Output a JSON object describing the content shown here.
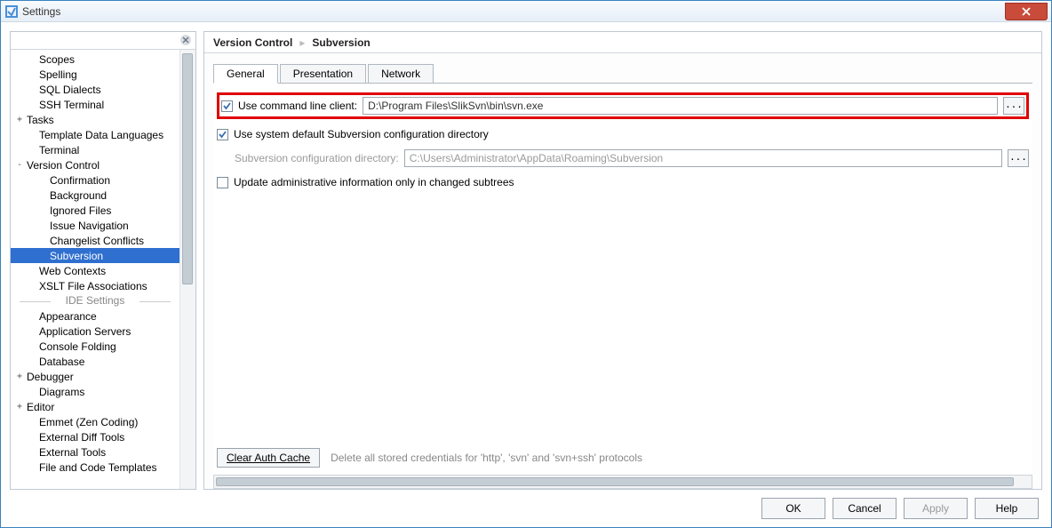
{
  "window": {
    "title": "Settings"
  },
  "breadcrumb": {
    "root": "Version Control",
    "leaf": "Subversion"
  },
  "tabs": {
    "general": "General",
    "presentation": "Presentation",
    "network": "Network"
  },
  "form": {
    "cli_label": "Use command line client:",
    "cli_value": "D:\\Program Files\\SlikSvn\\bin\\svn.exe",
    "sysdefault_label": "Use system default Subversion configuration directory",
    "confdir_label": "Subversion configuration directory:",
    "confdir_value": "C:\\Users\\Administrator\\AppData\\Roaming\\Subversion",
    "update_label": "Update administrative information only in changed subtrees",
    "clear_cache_btn": "Clear Auth Cache",
    "clear_cache_desc": "Delete all stored credentials for 'http', 'svn' and 'svn+ssh' protocols"
  },
  "tree": {
    "items": [
      {
        "label": "Scopes",
        "depth": 1
      },
      {
        "label": "Spelling",
        "depth": 1
      },
      {
        "label": "SQL Dialects",
        "depth": 1
      },
      {
        "label": "SSH Terminal",
        "depth": 1
      },
      {
        "label": "Tasks",
        "depth": 0,
        "exp": "+"
      },
      {
        "label": "Template Data Languages",
        "depth": 1
      },
      {
        "label": "Terminal",
        "depth": 1
      },
      {
        "label": "Version Control",
        "depth": 0,
        "exp": "-"
      },
      {
        "label": "Confirmation",
        "depth": 2
      },
      {
        "label": "Background",
        "depth": 2
      },
      {
        "label": "Ignored Files",
        "depth": 2
      },
      {
        "label": "Issue Navigation",
        "depth": 2
      },
      {
        "label": "Changelist Conflicts",
        "depth": 2
      },
      {
        "label": "Subversion",
        "depth": 2,
        "selected": true
      },
      {
        "label": "Web Contexts",
        "depth": 1
      },
      {
        "label": "XSLT File Associations",
        "depth": 1
      },
      {
        "section": "IDE Settings"
      },
      {
        "label": "Appearance",
        "depth": 1
      },
      {
        "label": "Application Servers",
        "depth": 1
      },
      {
        "label": "Console Folding",
        "depth": 1
      },
      {
        "label": "Database",
        "depth": 1
      },
      {
        "label": "Debugger",
        "depth": 0,
        "exp": "+"
      },
      {
        "label": "Diagrams",
        "depth": 1
      },
      {
        "label": "Editor",
        "depth": 0,
        "exp": "+"
      },
      {
        "label": "Emmet (Zen Coding)",
        "depth": 1
      },
      {
        "label": "External Diff Tools",
        "depth": 1
      },
      {
        "label": "External Tools",
        "depth": 1
      },
      {
        "label": "File and Code Templates",
        "depth": 1
      }
    ]
  },
  "buttons": {
    "ok": "OK",
    "cancel": "Cancel",
    "apply": "Apply",
    "help": "Help"
  }
}
